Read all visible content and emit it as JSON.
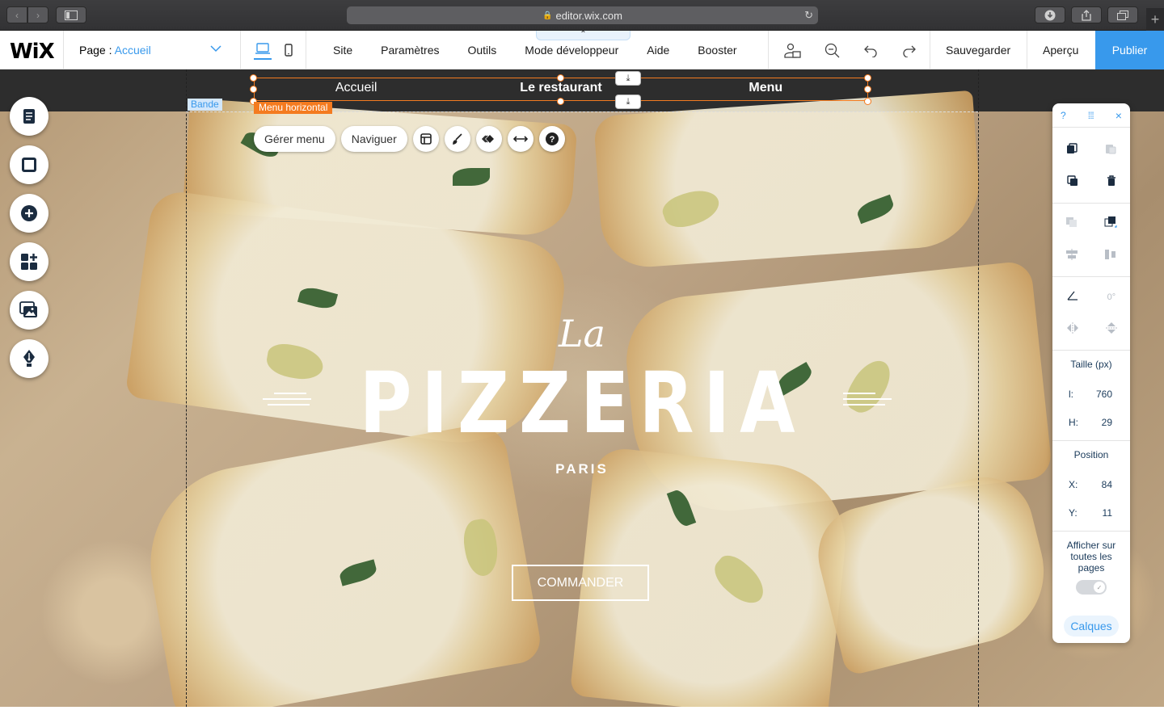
{
  "browser": {
    "url": "editor.wix.com",
    "icons": [
      "back-icon",
      "forward-icon",
      "sidebar-icon",
      "lock-icon",
      "reload-icon",
      "download-icon",
      "share-icon",
      "tabs-icon",
      "plus-icon"
    ]
  },
  "toolbar": {
    "logo": "WiX",
    "page_label": "Page :",
    "page_value": "Accueil",
    "menu": [
      "Site",
      "Paramètres",
      "Outils",
      "Mode développeur",
      "Aide",
      "Booster"
    ],
    "save_label": "Sauvegarder",
    "preview_label": "Aperçu",
    "publish_label": "Publier",
    "accent": "#3899ec"
  },
  "site": {
    "menu_items": [
      "Accueil",
      "Le restaurant",
      "Menu"
    ],
    "menu_tag": "Menu horizontal",
    "strip_tag": "Bande",
    "float_buttons": [
      "Gérer menu",
      "Naviguer"
    ],
    "hero_small": "La",
    "hero_title": "PIZZERIA",
    "hero_sub": "PARIS",
    "order_label": "COMMANDER",
    "selection_color": "#f47b20"
  },
  "panel": {
    "help": "?",
    "rotation": "0°",
    "size_label": "Taille (px)",
    "width_label": "l:",
    "width_value": "760",
    "height_label": "H:",
    "height_value": "29",
    "position_label": "Position",
    "x_label": "X:",
    "x_value": "84",
    "y_label": "Y:",
    "y_value": "11",
    "show_all_label": "Afficher sur toutes les pages",
    "show_all_on": true,
    "layers_label": "Calques"
  }
}
